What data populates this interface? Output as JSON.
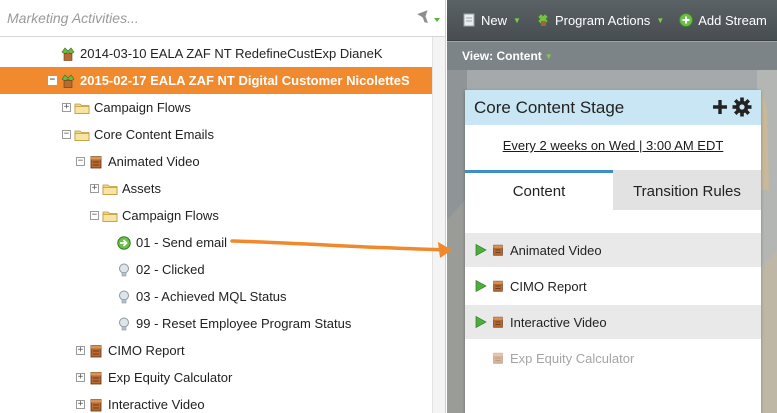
{
  "search": {
    "placeholder": "Marketing Activities..."
  },
  "tree": [
    {
      "label": "2014-03-10 EALA ZAF NT RedefineCustExp DianeK",
      "icon": "program-icon",
      "indent": 60,
      "expander": "",
      "selected": false
    },
    {
      "label": "2015-02-17 EALA ZAF NT Digital Customer NicoletteS",
      "icon": "program-icon",
      "indent": 48,
      "expander": "−",
      "selected": true
    },
    {
      "label": "Campaign Flows",
      "icon": "folder-icon",
      "indent": 62,
      "expander": "+",
      "selected": false
    },
    {
      "label": "Core Content Emails",
      "icon": "folder-icon",
      "indent": 62,
      "expander": "−",
      "selected": false
    },
    {
      "label": "Animated Video",
      "icon": "program-box-icon",
      "indent": 76,
      "expander": "−",
      "selected": false
    },
    {
      "label": "Assets",
      "icon": "folder-icon",
      "indent": 90,
      "expander": "+",
      "selected": false
    },
    {
      "label": "Campaign Flows",
      "icon": "folder-icon",
      "indent": 90,
      "expander": "−",
      "selected": false
    },
    {
      "label": "01 - Send email",
      "icon": "trigger-campaign-icon",
      "indent": 116,
      "expander": "",
      "selected": false
    },
    {
      "label": "02 - Clicked",
      "icon": "smart-campaign-icon",
      "indent": 116,
      "expander": "",
      "selected": false
    },
    {
      "label": "03 - Achieved MQL Status",
      "icon": "smart-campaign-icon",
      "indent": 116,
      "expander": "",
      "selected": false
    },
    {
      "label": "99 - Reset Employee Program Status",
      "icon": "smart-campaign-icon",
      "indent": 116,
      "expander": "",
      "selected": false
    },
    {
      "label": "CIMO Report",
      "icon": "program-box-icon",
      "indent": 76,
      "expander": "+",
      "selected": false
    },
    {
      "label": "Exp Equity Calculator",
      "icon": "program-box-icon",
      "indent": 76,
      "expander": "+",
      "selected": false
    },
    {
      "label": "Interactive Video",
      "icon": "program-box-icon",
      "indent": 76,
      "expander": "+",
      "selected": false
    }
  ],
  "toolbar": {
    "new_label": "New",
    "program_actions_label": "Program Actions",
    "add_stream_label": "Add Stream"
  },
  "view_bar": {
    "label": "View: Content"
  },
  "card": {
    "title": "Core Content Stage",
    "schedule": "Every 2 weeks on Wed | 3:00 AM EDT",
    "tabs": {
      "content": "Content",
      "transition_rules": "Transition Rules"
    },
    "items": [
      {
        "label": "Animated Video",
        "active": true
      },
      {
        "label": "CIMO Report",
        "active": true
      },
      {
        "label": "Interactive Video",
        "active": true
      },
      {
        "label": "Exp Equity Calculator",
        "active": false
      }
    ]
  },
  "colors": {
    "selected_row": "#f18a2f",
    "toolbar": "#4f5659",
    "tab_active_border": "#3f8ec8",
    "card_header": "#c9e6f4",
    "arrow": "#f0892c",
    "play": "#4caf3c"
  }
}
